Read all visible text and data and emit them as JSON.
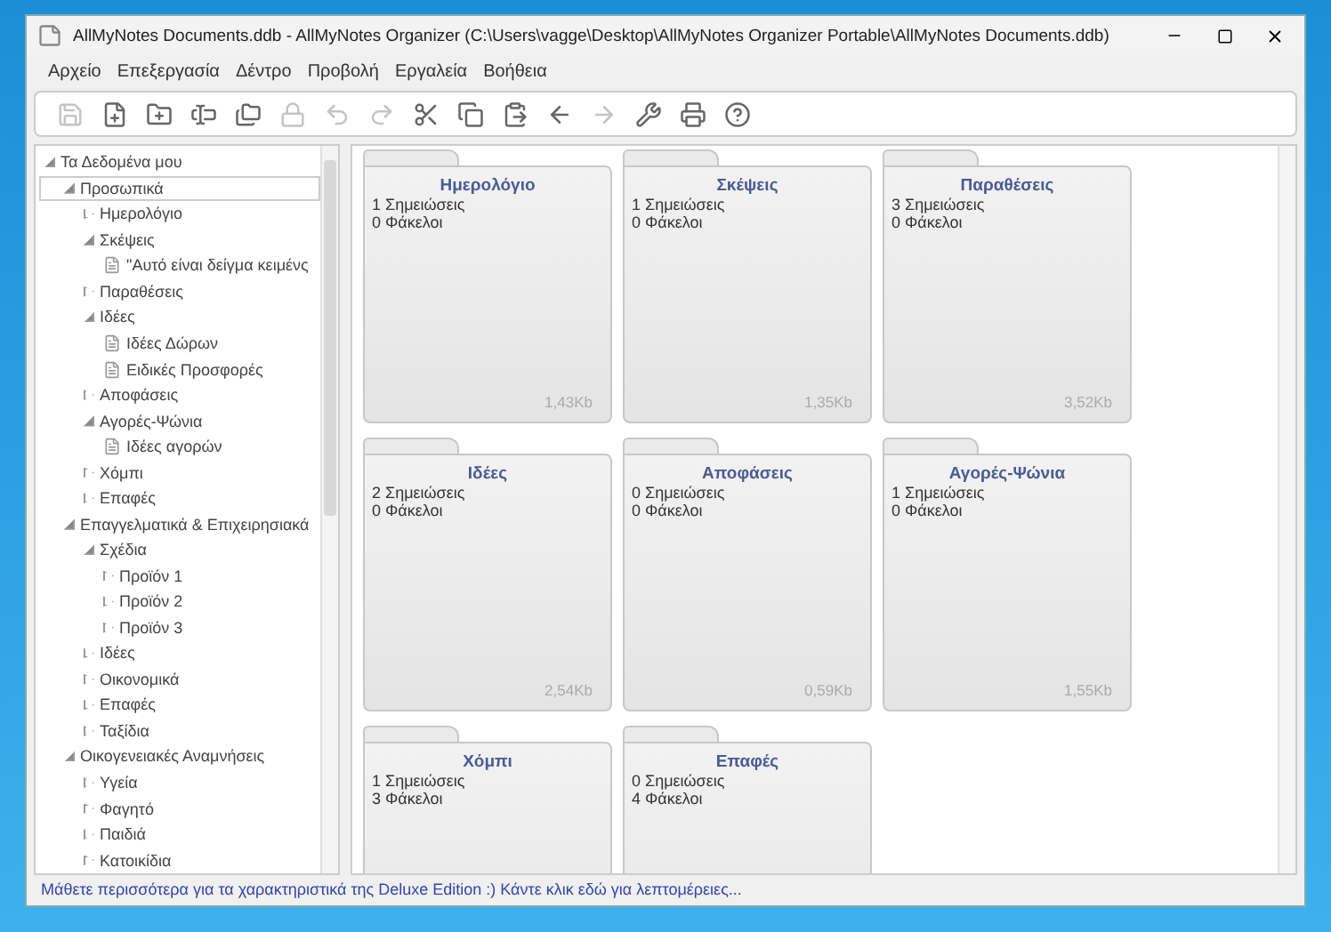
{
  "window": {
    "title": "AllMyNotes Documents.ddb - AllMyNotes Organizer (C:\\Users\\vagge\\Desktop\\AllMyNotes Organizer Portable\\AllMyNotes Documents.ddb)"
  },
  "menu": [
    "Αρχείο",
    "Επεξεργασία",
    "Δέντρο",
    "Προβολή",
    "Εργαλεία",
    "Βοήθεια"
  ],
  "toolbar": [
    {
      "disabled": true
    },
    {
      "disabled": false
    },
    {
      "disabled": false
    },
    {
      "disabled": false
    },
    {
      "disabled": false
    },
    {
      "disabled": true
    },
    {
      "disabled": true
    },
    {
      "disabled": true
    },
    {
      "disabled": false
    },
    {
      "disabled": false
    },
    {
      "disabled": false
    },
    {
      "disabled": false
    },
    {
      "disabled": true
    },
    {
      "disabled": false
    },
    {
      "disabled": false
    },
    {
      "disabled": false
    }
  ],
  "tree": [
    {
      "label": "Τα Δεδομένα μου",
      "kind": "folder",
      "expanded": true,
      "selected": false,
      "children": [
        {
          "label": "Προσωπικά",
          "kind": "folder",
          "expanded": true,
          "selected": true,
          "children": [
            {
              "label": "Ημερολόγιο",
              "kind": "folder",
              "expanded": false,
              "selected": false
            },
            {
              "label": "Σκέψεις",
              "kind": "folder",
              "expanded": true,
              "selected": false,
              "children": [
                {
                  "label": "\"Αυτό είναι δείγμα κειμένς",
                  "kind": "note",
                  "selected": false
                }
              ]
            },
            {
              "label": "Παραθέσεις",
              "kind": "folder",
              "expanded": false,
              "selected": false
            },
            {
              "label": "Ιδέες",
              "kind": "folder",
              "expanded": true,
              "selected": false,
              "children": [
                {
                  "label": "Ιδέες Δώρων",
                  "kind": "note",
                  "selected": false
                },
                {
                  "label": "Ειδικές Προσφορές",
                  "kind": "note",
                  "selected": false
                }
              ]
            },
            {
              "label": "Αποφάσεις",
              "kind": "folder",
              "expanded": false,
              "selected": false
            },
            {
              "label": "Αγορές-Ψώνια",
              "kind": "folder",
              "expanded": true,
              "selected": false,
              "children": [
                {
                  "label": "Ιδέες αγορών",
                  "kind": "note",
                  "selected": false
                }
              ]
            },
            {
              "label": "Χόμπι",
              "kind": "folder",
              "expanded": false,
              "selected": false
            },
            {
              "label": "Επαφές",
              "kind": "folder",
              "expanded": false,
              "selected": false
            }
          ]
        },
        {
          "label": "Επαγγελματικά & Επιχειρησιακά",
          "kind": "folder",
          "expanded": true,
          "selected": false,
          "children": [
            {
              "label": "Σχέδια",
              "kind": "folder",
              "expanded": true,
              "selected": false,
              "children": [
                {
                  "label": "Προϊόν 1",
                  "kind": "folder",
                  "expanded": false,
                  "selected": false
                },
                {
                  "label": "Προϊόν 2",
                  "kind": "folder",
                  "expanded": false,
                  "selected": false
                },
                {
                  "label": "Προϊόν 3",
                  "kind": "folder",
                  "expanded": false,
                  "selected": false
                }
              ]
            },
            {
              "label": "Ιδέες",
              "kind": "folder",
              "expanded": false,
              "selected": false
            },
            {
              "label": "Οικονομικά",
              "kind": "folder",
              "expanded": false,
              "selected": false
            },
            {
              "label": "Επαφές",
              "kind": "folder",
              "expanded": false,
              "selected": false
            },
            {
              "label": "Ταξίδια",
              "kind": "folder",
              "expanded": false,
              "selected": false
            }
          ]
        },
        {
          "label": "Οικογενειακές Αναμνήσεις",
          "kind": "folder",
          "expanded": true,
          "selected": false,
          "children": [
            {
              "label": "Υγεία",
              "kind": "folder",
              "expanded": false,
              "selected": false
            },
            {
              "label": "Φαγητό",
              "kind": "folder",
              "expanded": false,
              "selected": false
            },
            {
              "label": "Παιδιά",
              "kind": "folder",
              "expanded": false,
              "selected": false
            },
            {
              "label": "Κατοικίδια",
              "kind": "folder",
              "expanded": false,
              "selected": false
            }
          ]
        }
      ]
    }
  ],
  "cards": [
    {
      "title": "Ημερολόγιο",
      "notes": "1 Σημειώσεις",
      "folders": "0 Φάκελοι",
      "size": "1,43Kb"
    },
    {
      "title": "Σκέψεις",
      "notes": "1 Σημειώσεις",
      "folders": "0 Φάκελοι",
      "size": "1,35Kb"
    },
    {
      "title": "Παραθέσεις",
      "notes": "3 Σημειώσεις",
      "folders": "0 Φάκελοι",
      "size": "3,52Kb"
    },
    {
      "title": "Ιδέες",
      "notes": "2 Σημειώσεις",
      "folders": "0 Φάκελοι",
      "size": "2,54Kb"
    },
    {
      "title": "Αποφάσεις",
      "notes": "0 Σημειώσεις",
      "folders": "0 Φάκελοι",
      "size": "0,59Kb"
    },
    {
      "title": "Αγορές-Ψώνια",
      "notes": "1 Σημειώσεις",
      "folders": "0 Φάκελοι",
      "size": "1,55Kb"
    },
    {
      "title": "Χόμπι",
      "notes": "1 Σημειώσεις",
      "folders": "3 Φάκελοι"
    },
    {
      "title": "Επαφές",
      "notes": "0 Σημειώσεις",
      "folders": "4 Φάκελοι"
    }
  ],
  "status_bar": {
    "link": "Μάθετε περισσότερα για τα χαρακτηριστικά της Deluxe Edition :) Κάντε κλικ εδώ για λεπτομέρειες..."
  }
}
